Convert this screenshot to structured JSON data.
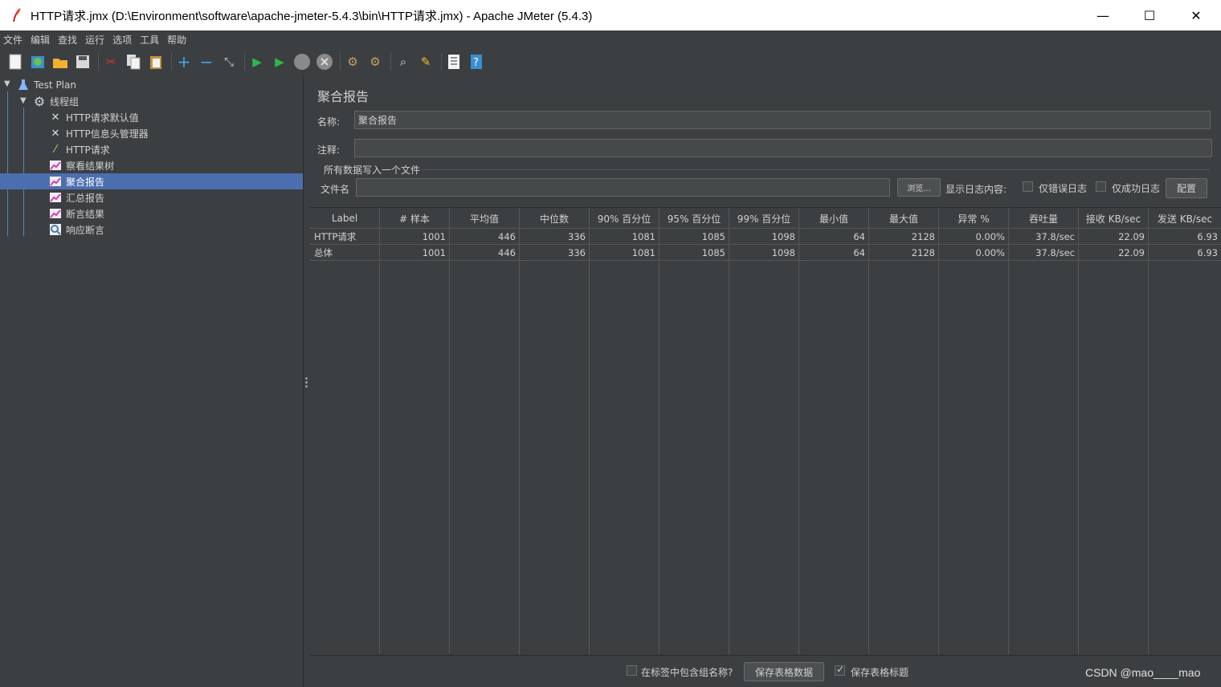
{
  "window": {
    "title": "HTTP请求.jmx (D:\\Environment\\software\\apache-jmeter-5.4.3\\bin\\HTTP请求.jmx) - Apache JMeter (5.4.3)",
    "min_glyph": "—",
    "max_glyph": "☐",
    "close_glyph": "✕"
  },
  "menu": [
    "文件",
    "编辑",
    "查找",
    "运行",
    "选项",
    "工具",
    "帮助"
  ],
  "tree": {
    "root": "Test Plan",
    "thread_group": "线程组",
    "items": [
      {
        "label": "HTTP请求默认值",
        "icon": "wrench-icon"
      },
      {
        "label": "HTTP信息头管理器",
        "icon": "wrench-icon"
      },
      {
        "label": "HTTP请求",
        "icon": "pipette-icon"
      },
      {
        "label": "察看结果树",
        "icon": "chart-icon"
      },
      {
        "label": "聚合报告",
        "icon": "chart-icon",
        "selected": true
      },
      {
        "label": "汇总报告",
        "icon": "chart-icon"
      },
      {
        "label": "断言结果",
        "icon": "chart-icon"
      },
      {
        "label": "响应断言",
        "icon": "magnifier-icon"
      }
    ]
  },
  "panel": {
    "title": "聚合报告",
    "name_label": "名称:",
    "name_value": "聚合报告",
    "comment_label": "注释:",
    "comment_value": "",
    "file_group_label": "所有数据写入一个文件",
    "filename_label": "文件名",
    "filename_value": "",
    "browse_button": "浏览...",
    "log_content_label": "显示日志内容:",
    "errors_only_label": "仅错误日志",
    "success_only_label": "仅成功日志",
    "configure_button": "配置"
  },
  "table": {
    "headers": [
      "Label",
      "# 样本",
      "平均值",
      "中位数",
      "90% 百分位",
      "95% 百分位",
      "99% 百分位",
      "最小值",
      "最大值",
      "异常 %",
      "吞吐量",
      "接收 KB/sec",
      "发送 KB/sec"
    ],
    "rows": [
      [
        "HTTP请求",
        "1001",
        "446",
        "336",
        "1081",
        "1085",
        "1098",
        "64",
        "2128",
        "0.00%",
        "37.8/sec",
        "22.09",
        "6.93"
      ],
      [
        "总体",
        "1001",
        "446",
        "336",
        "1081",
        "1085",
        "1098",
        "64",
        "2128",
        "0.00%",
        "37.8/sec",
        "22.09",
        "6.93"
      ]
    ]
  },
  "footer": {
    "include_group_label": "在标签中包含组名称?",
    "save_data_button": "保存表格数据",
    "save_header_label": "保存表格标题",
    "save_header_checked": true
  },
  "watermark": "CSDN @mao____mao"
}
